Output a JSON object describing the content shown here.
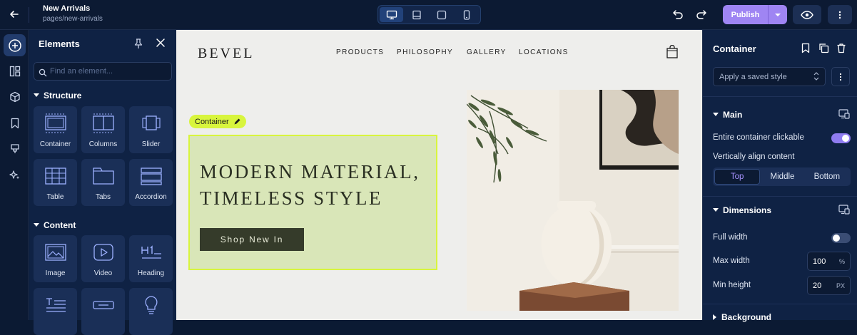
{
  "topbar": {
    "title": "New Arrivals",
    "path": "pages/new-arrivals",
    "publish_label": "Publish"
  },
  "elements_panel": {
    "title": "Elements",
    "search_placeholder": "Find an element...",
    "sections": [
      {
        "label": "Structure",
        "items": [
          "Container",
          "Columns",
          "Slider",
          "Table",
          "Tabs",
          "Accordion"
        ]
      },
      {
        "label": "Content",
        "items": [
          "Image",
          "Video",
          "Heading"
        ]
      }
    ]
  },
  "canvas": {
    "logo": "BEVEL",
    "nav": [
      "PRODUCTS",
      "PHILOSOPHY",
      "GALLERY",
      "LOCATIONS"
    ],
    "badge_label": "Container",
    "headline_line1": "MODERN MATERIAL,",
    "headline_line2": "TIMELESS STYLE",
    "cta_label": "Shop New In"
  },
  "properties": {
    "title": "Container",
    "saved_style_placeholder": "Apply a saved style",
    "main": {
      "label": "Main",
      "clickable_label": "Entire container clickable",
      "clickable_on": true,
      "valign_label": "Vertically align content",
      "valign_options": [
        "Top",
        "Middle",
        "Bottom"
      ],
      "valign_selected": "Top"
    },
    "dimensions": {
      "label": "Dimensions",
      "full_width_label": "Full width",
      "full_width_on": false,
      "max_width_label": "Max width",
      "max_width_value": "100",
      "max_width_unit": "%",
      "min_height_label": "Min height",
      "min_height_value": "20",
      "min_height_unit": "PX"
    },
    "background_label": "Background"
  },
  "colors": {
    "accent": "#9f85f3",
    "highlight": "#d8f53d",
    "panel": "#0f2244"
  }
}
